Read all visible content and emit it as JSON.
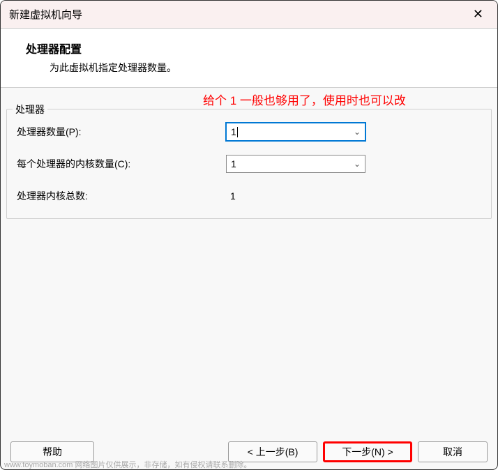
{
  "titlebar": {
    "title": "新建虚拟机向导"
  },
  "header": {
    "title": "处理器配置",
    "subtitle": "为此虚拟机指定处理器数量。"
  },
  "annotation": {
    "text": "给个 1 一般也够用了，使用时也可以改"
  },
  "fieldset": {
    "legend": "处理器",
    "rows": {
      "processor_count": {
        "label": "处理器数量(P):",
        "value": "1"
      },
      "cores_per_processor": {
        "label": "每个处理器的内核数量(C):",
        "value": "1"
      },
      "total_cores": {
        "label": "处理器内核总数:",
        "value": "1"
      }
    }
  },
  "buttons": {
    "help": "帮助",
    "back": "< 上一步(B)",
    "next": "下一步(N) >",
    "cancel": "取消"
  },
  "watermark": "www.toymoban.com  网络图片仅供展示，非存储，如有侵权请联系删除。"
}
